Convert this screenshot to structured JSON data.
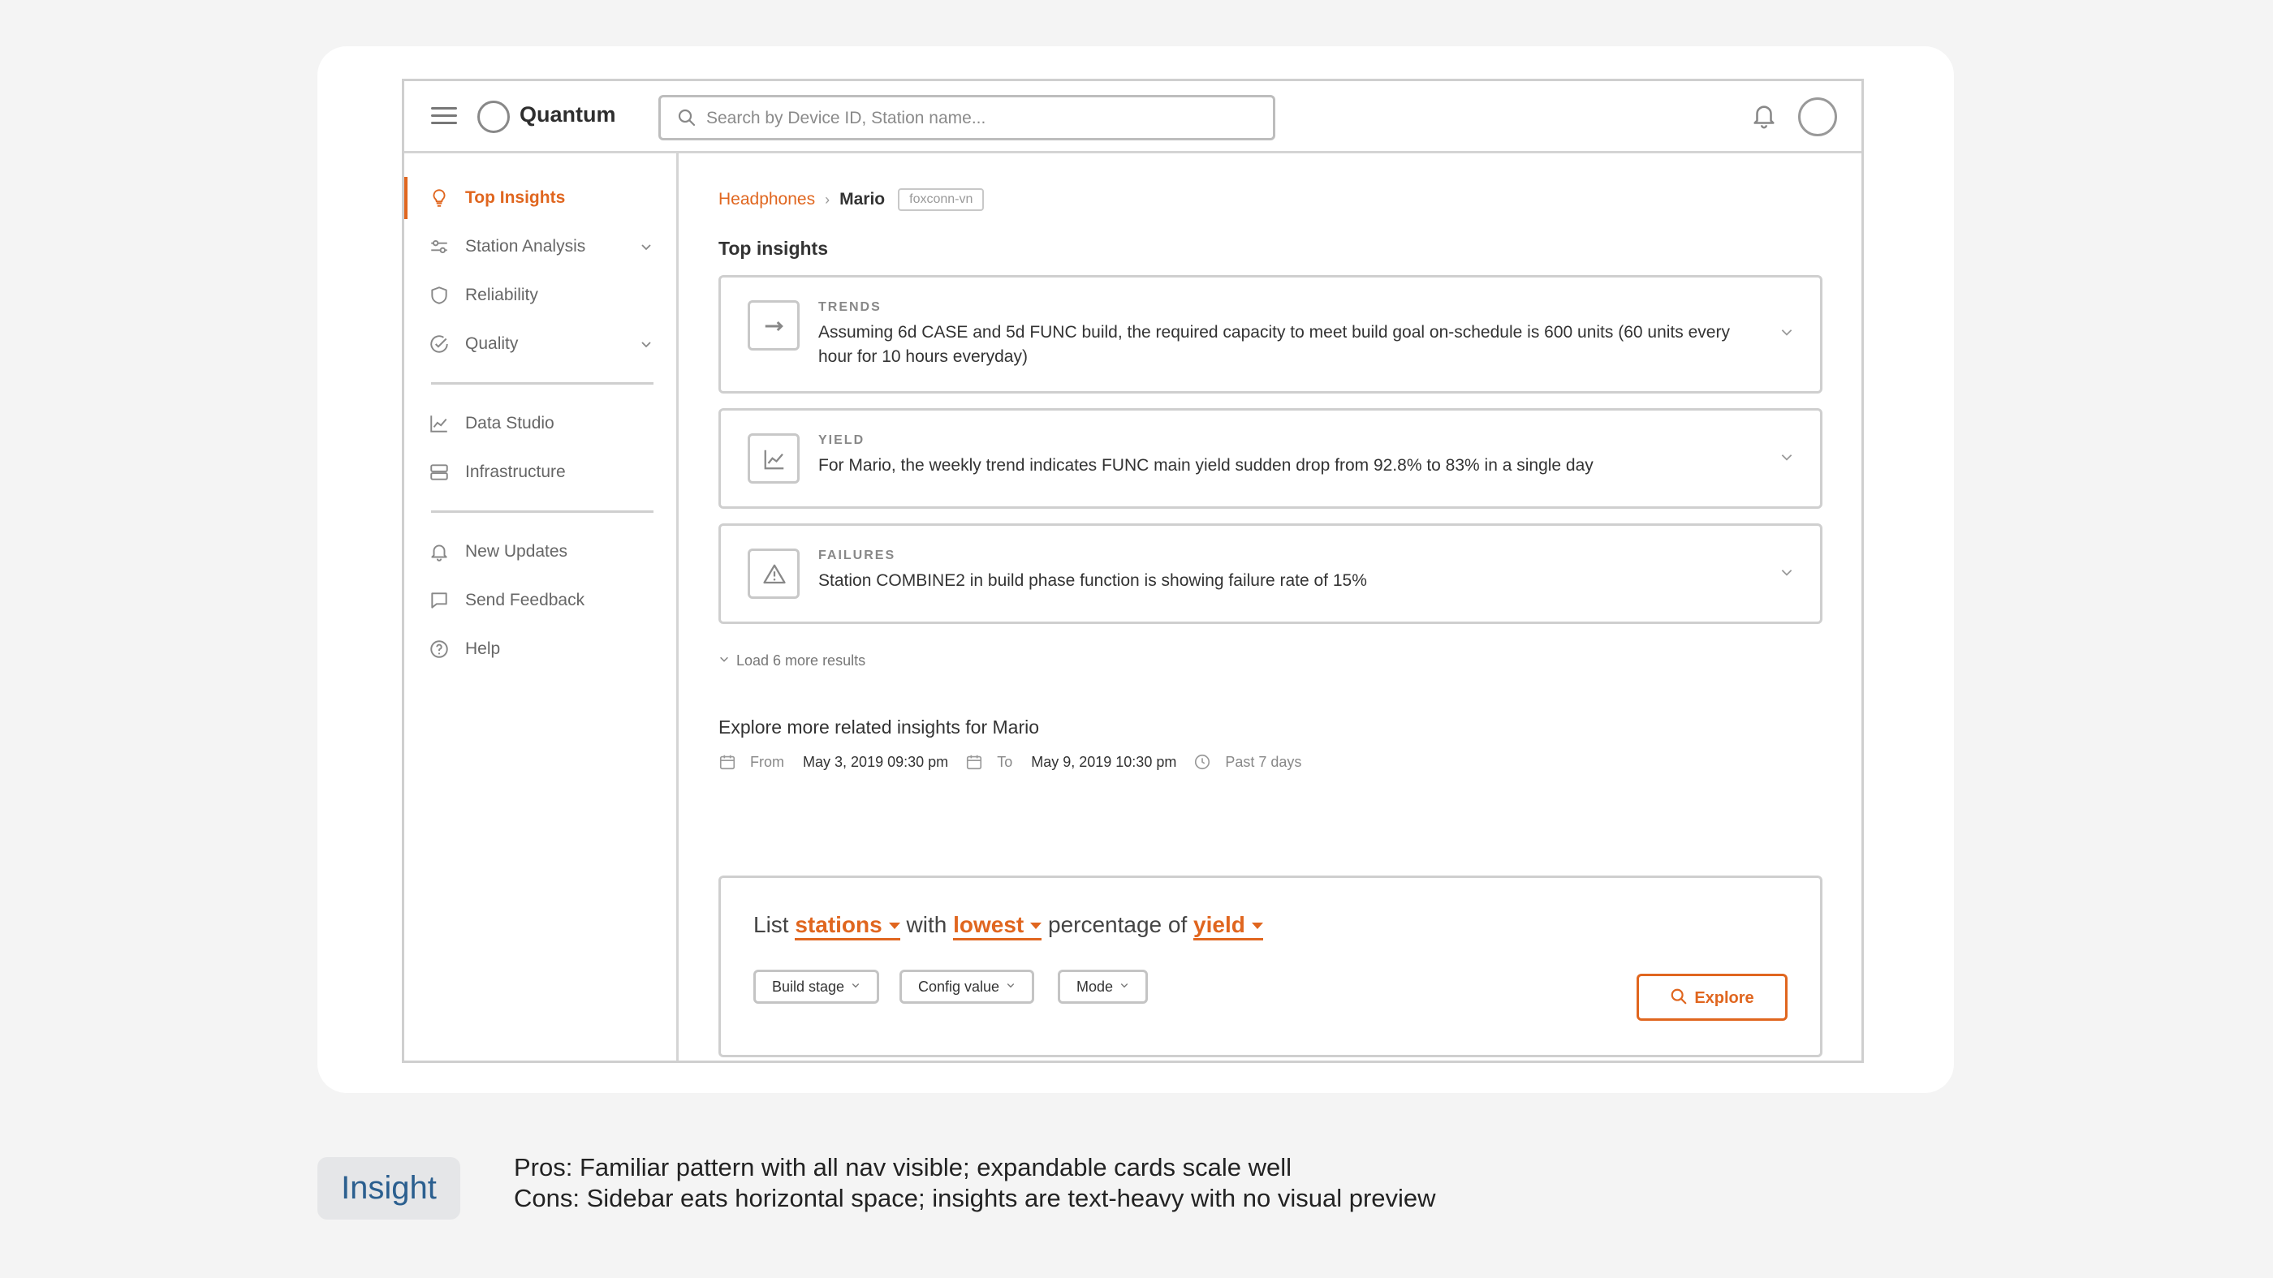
{
  "header": {
    "brand": "Quantum",
    "search_placeholder": "Search by Device ID, Station name...",
    "icons": [
      "menu-icon",
      "logo-icon",
      "search-icon",
      "bell-icon",
      "avatar"
    ]
  },
  "sidebar": {
    "items": [
      {
        "label": "Top Insights",
        "icon": "lightbulb-icon",
        "active": true
      },
      {
        "label": "Station Analysis",
        "icon": "sliders-icon",
        "expandable": true
      },
      {
        "label": "Reliability",
        "icon": "shield-icon"
      },
      {
        "label": "Quality",
        "icon": "check-circle-icon",
        "expandable": true
      },
      {
        "label": "Data Studio",
        "icon": "line-chart-icon"
      },
      {
        "label": "Infrastructure",
        "icon": "server-icon"
      },
      {
        "label": "New Updates",
        "icon": "bell-icon"
      },
      {
        "label": "Send Feedback",
        "icon": "message-icon"
      },
      {
        "label": "Help",
        "icon": "help-circle-icon"
      }
    ]
  },
  "breadcrumb": {
    "root": "Headphones",
    "current": "Mario",
    "tag": "foxconn-vn"
  },
  "top_insights": {
    "title": "Top insights",
    "cards": [
      {
        "kicker": "TRENDS",
        "icon": "arrow-right-icon",
        "text": "Assuming 6d CASE and 5d FUNC build, the required capacity to meet build goal on-schedule is 600 units (60 units every hour for 10 hours everyday)"
      },
      {
        "kicker": "YIELD",
        "icon": "chart-icon",
        "text": "For Mario, the weekly trend indicates FUNC main yield sudden drop from 92.8% to 83% in a single day"
      },
      {
        "kicker": "FAILURES",
        "icon": "warning-icon",
        "text": "Station COMBINE2 in build phase function is showing failure rate of 15%"
      }
    ],
    "load_more": "Load 6 more results"
  },
  "explore": {
    "title": "Explore more related insights for Mario",
    "from_label": "From",
    "from_value": "May 3, 2019 09:30 pm",
    "to_label": "To",
    "to_value": "May 9, 2019 10:30 pm",
    "range": "Past 7 days",
    "query": {
      "w1": "List",
      "t1": "stations",
      "w2": "with",
      "t2": "lowest",
      "w3": "percentage of",
      "t3": "yield"
    },
    "filters": [
      "Build stage",
      "Config value",
      "Mode"
    ],
    "button": "Explore"
  },
  "note": {
    "badge": "Insight",
    "pros": "Pros: Familiar pattern with all nav visible; expandable cards scale well",
    "cons": "Cons: Sidebar eats horizontal space; insights are text-heavy with no visual preview"
  },
  "colors": {
    "accent": "#e0661f",
    "badge_text": "#2b5f8f",
    "border": "#cfcfcf"
  }
}
